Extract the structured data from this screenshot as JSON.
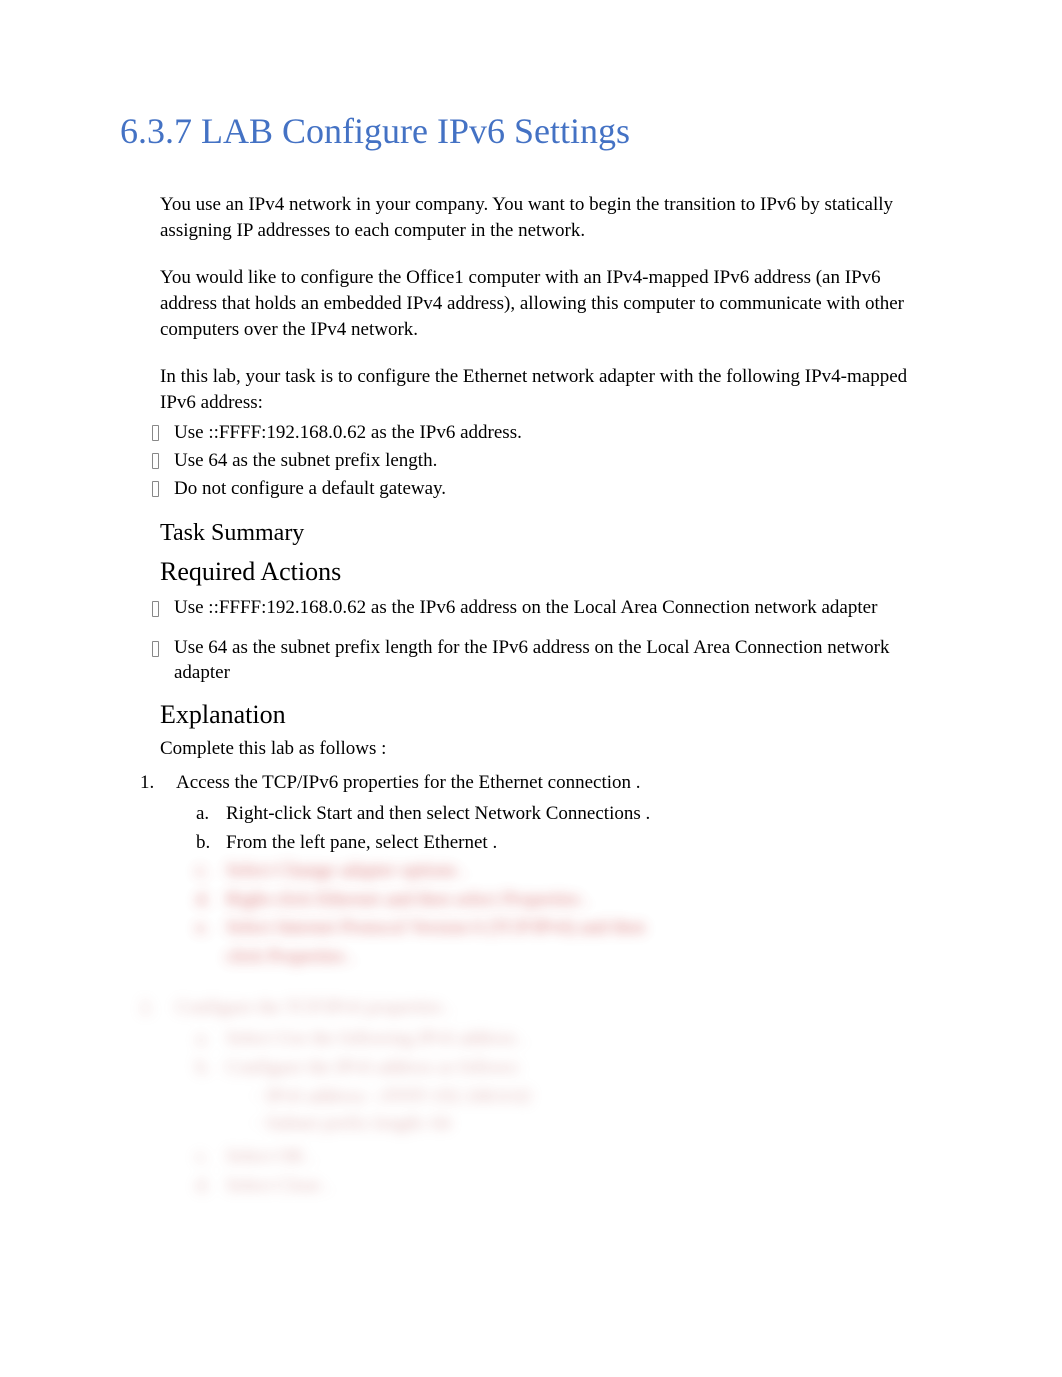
{
  "title": "6.3.7 LAB Configure IPv6 Settings",
  "intro": {
    "p1": "You use an IPv4 network in your company. You want to begin the transition to IPv6 by statically assigning IP addresses to each computer in the network.",
    "p2": "You would like to configure the Office1 computer with an IPv4-mapped IPv6 address (an IPv6 address that holds an embedded IPv4 address), allowing this computer to communicate with other computers over the IPv4 network.",
    "p3": "In this lab, your task is to configure the Ethernet network adapter with the following IPv4-mapped IPv6 address:"
  },
  "task_bullets": [
    {
      "pre": "Use ",
      "code": "::FFFF:192.168.0.62",
      "post": "  as the IPv6 address."
    },
    {
      "pre": "Use ",
      "code": "64",
      "post": " as the subnet prefix length."
    },
    {
      "pre": "",
      "code": "",
      "post": "Do not configure a default gateway."
    }
  ],
  "task_summary_heading": "Task Summary",
  "required_heading": "Required Actions",
  "required_actions": [
    "Use ::FFFF:192.168.0.62 as the IPv6 address on the Local Area Connection network adapter",
    "Use 64 as the subnet prefix length for the IPv6 address on the Local Area Connection network adapter"
  ],
  "explanation_heading": "Explanation",
  "steps_intro": "Complete this lab as follows        :",
  "step1": {
    "num": "1.",
    "text": "Access the TCP/IPv6 properties for the Ethernet connection            .",
    "a": {
      "let": "a.",
      "t1": "Right-click Start   and then select    ",
      "bold": "Network Connections",
      "t2": "     ."
    },
    "b": {
      "let": "b.",
      "t1": "From the left pane, select     ",
      "bold": "Ethernet",
      "t2": "   ."
    },
    "blurred": [
      {
        "let": "c.",
        "text": "Select  Change adapter options       ."
      },
      {
        "let": "d.",
        "text": "Right-click Ethernet    and then select     Properties    ."
      },
      {
        "let": "e.",
        "text": "Select  Internet Protocol Version 6 (TCP/IPv6)          and then"
      },
      {
        "let": "",
        "text": "click Properties   ."
      }
    ]
  },
  "step2": {
    "num": "2.",
    "text": "Configure the TCP/IPv6 properties        .",
    "subs": [
      {
        "let": "a.",
        "text": "Select  Use the following IPv6 address       ."
      },
      {
        "let": "b.",
        "text": "Configure the IPv6 address as follows:"
      },
      {
        "indent": true,
        "text": "IPv6 address:     ::FFFF:192.168.0.62"
      },
      {
        "indent": true,
        "text": "Subnet prefix length:     64"
      },
      {
        "let": "c.",
        "text": "Select  OK ."
      },
      {
        "let": "d.",
        "text": "Select  Close ."
      }
    ]
  }
}
